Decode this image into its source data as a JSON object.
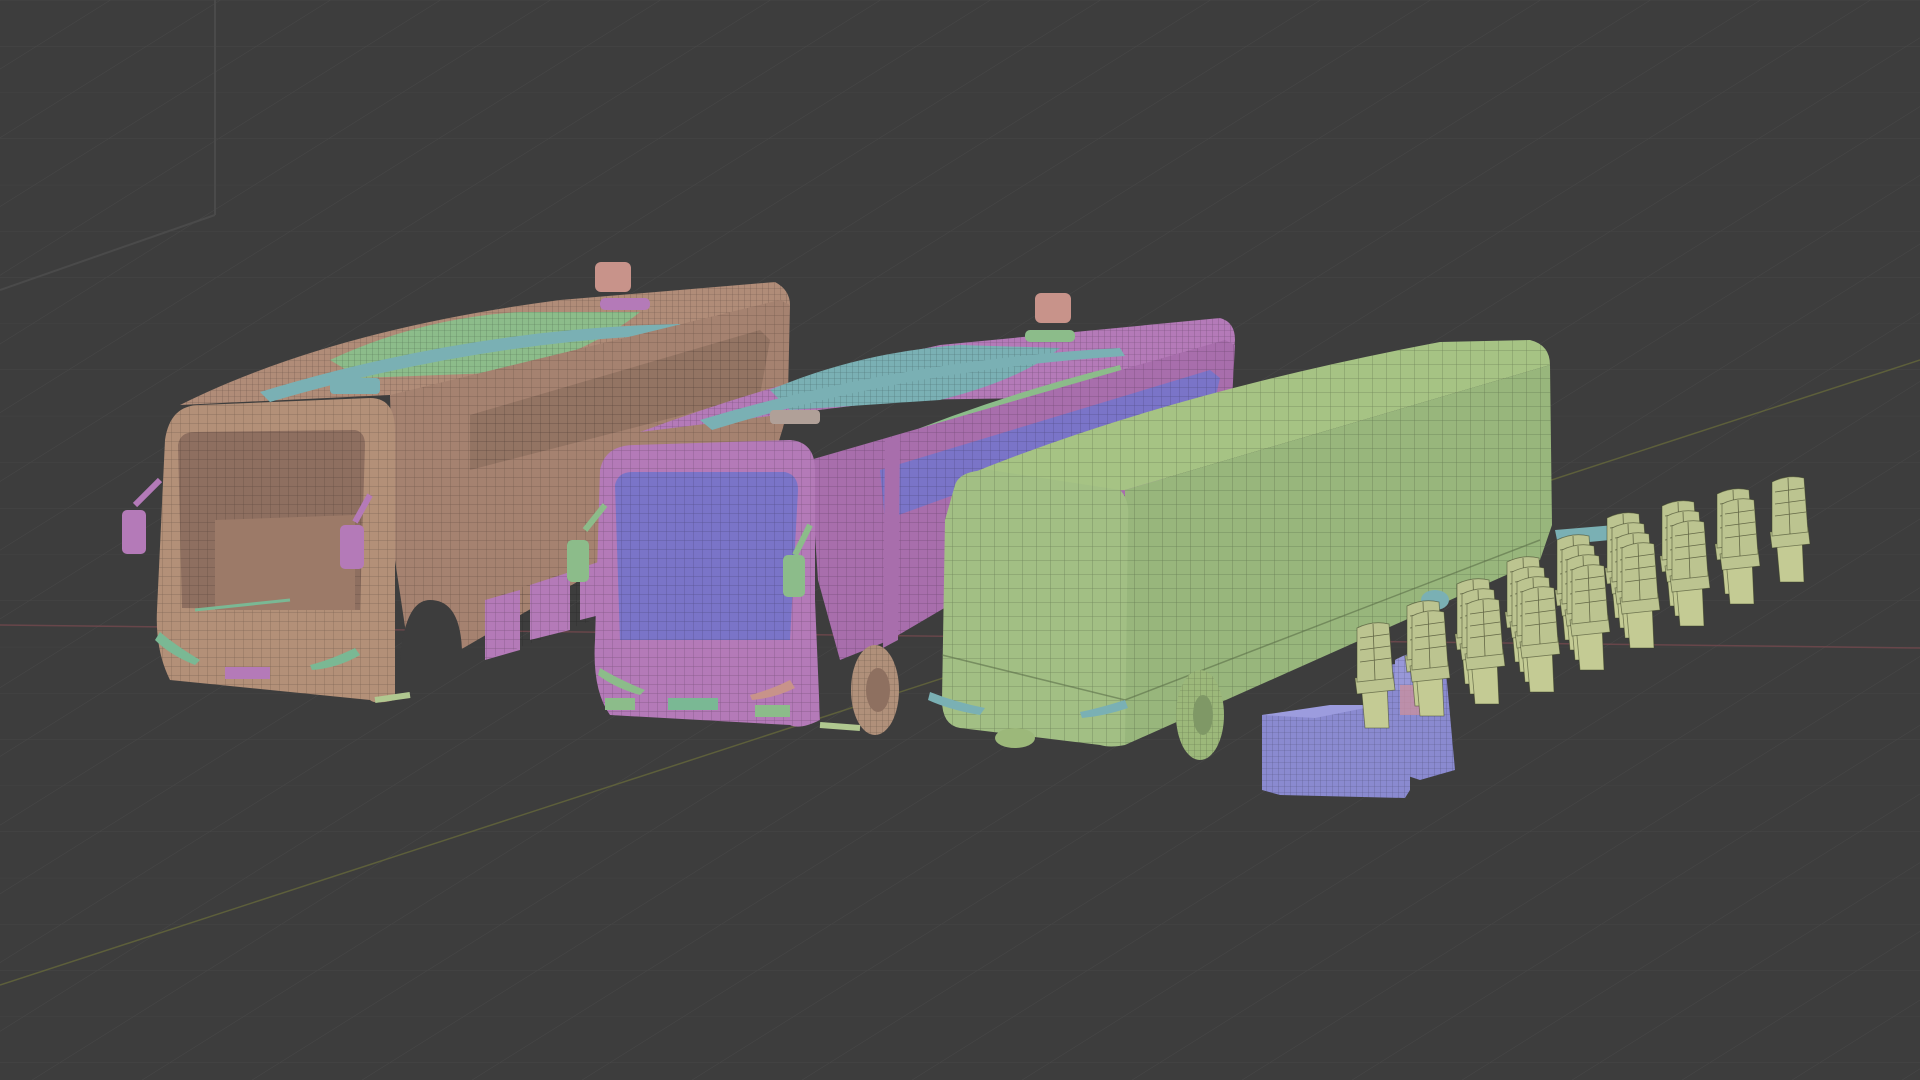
{
  "viewport": {
    "background": "#3d3d3d",
    "grid_color": "#474747",
    "x_axis_color": "#8a4a50",
    "y_axis_color": "#6b7a3a"
  },
  "models": [
    {
      "name": "bus-body-shell",
      "color": "#b08c78",
      "accent": "#7ab894"
    },
    {
      "name": "bus-exterior-panels",
      "color": "#b47ab8",
      "accent": "#7ab0b4"
    },
    {
      "name": "bus-collision-proxy",
      "color": "#9cb87a"
    },
    {
      "name": "driver-cockpit",
      "color": "#8a8ad0"
    },
    {
      "name": "passenger-seats",
      "color": "#bcc490",
      "count": 24
    }
  ]
}
